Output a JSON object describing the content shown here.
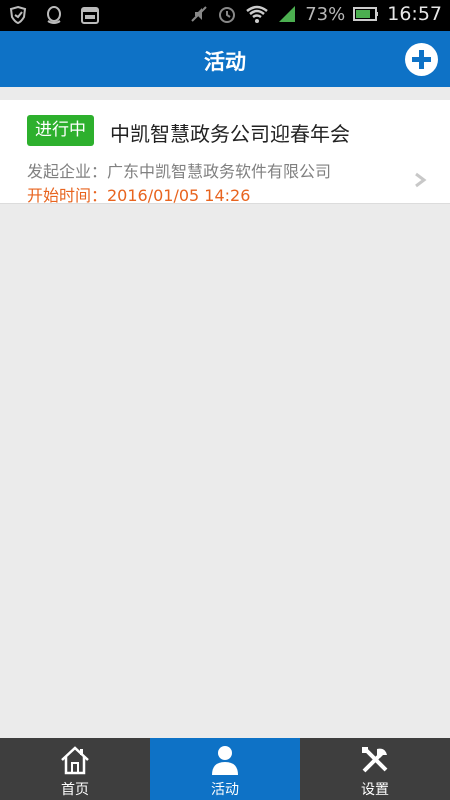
{
  "status_bar": {
    "battery_percent": "73%",
    "time": "16:57",
    "icons": [
      "shield-icon",
      "qq-icon",
      "calendar-365-icon",
      "mute-icon",
      "alarm-icon",
      "wifi-icon",
      "signal-icon",
      "battery-icon"
    ]
  },
  "header": {
    "title": "活动",
    "add_icon": "plus-circle-icon"
  },
  "activities": [
    {
      "status": "进行中",
      "title": "中凯智慧政务公司迎春年会",
      "organizer": "发起企业：广东中凯智慧政务软件有限公司",
      "start_time": "开始时间：2016/01/05 14:26"
    }
  ],
  "bottom_nav": {
    "items": [
      {
        "label": "首页",
        "icon": "home-icon",
        "active": false
      },
      {
        "label": "活动",
        "icon": "person-icon",
        "active": true
      },
      {
        "label": "设置",
        "icon": "tools-icon",
        "active": false
      }
    ]
  },
  "colors": {
    "header_bg": "#0e72c6",
    "badge_bg": "#2db02d",
    "time_text": "#e8641f",
    "nav_bg": "#3e3e3e"
  }
}
